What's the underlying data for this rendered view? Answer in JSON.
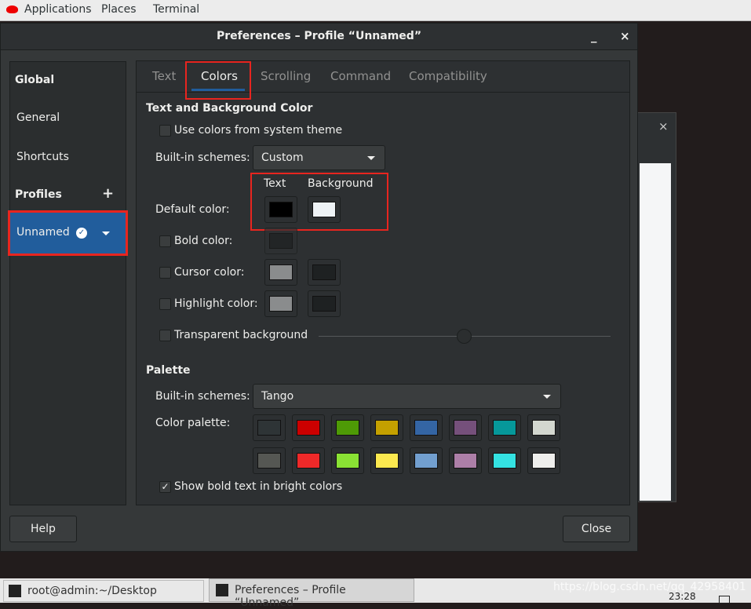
{
  "topbar": {
    "menus": [
      "Applications",
      "Places",
      "Terminal"
    ]
  },
  "dialog": {
    "title": "Preferences – Profile “Unnamed”",
    "close": "×"
  },
  "sidebar": {
    "global": "Global",
    "general": "General",
    "shortcuts": "Shortcuts",
    "profiles": "Profiles",
    "add": "+",
    "profile_name": "Unnamed"
  },
  "tabs": [
    "Text",
    "Colors",
    "Scrolling",
    "Command",
    "Compatibility"
  ],
  "text_bg": {
    "heading": "Text and Background Color",
    "use_system": "Use colors from system theme",
    "use_system_checked": false,
    "schemes_label": "Built-in schemes:",
    "scheme": "Custom",
    "col_text": "Text",
    "col_background": "Background",
    "default_label": "Default color:",
    "default_text": "#000000",
    "default_bg": "#eef2f5",
    "bold_label": "Bold color:",
    "bold_color": "#1e2122",
    "cursor_label": "Cursor color:",
    "cursor_fg": "#8a8c8d",
    "cursor_bg": "#1e2122",
    "highlight_label": "Highlight color:",
    "highlight_fg": "#8a8c8d",
    "highlight_bg": "#1e2122",
    "transparent_label": "Transparent background"
  },
  "palette": {
    "heading": "Palette",
    "schemes_label": "Built-in schemes:",
    "scheme": "Tango",
    "palette_label": "Color palette:",
    "colors": [
      "#2e3436",
      "#cc0000",
      "#4e9a06",
      "#c4a000",
      "#3465a4",
      "#75507b",
      "#06989a",
      "#d3d7cf",
      "#555753",
      "#ef2929",
      "#8ae234",
      "#fce94f",
      "#729fcf",
      "#ad7fa8",
      "#34e2e2",
      "#eeeeec"
    ],
    "bold_bright": "Show bold text in bright colors",
    "bold_bright_checked": true
  },
  "buttons": {
    "help": "Help",
    "close": "Close"
  },
  "taskbar": {
    "items": [
      "root@admin:~/Desktop",
      "Preferences – Profile “Unnamed”"
    ],
    "clock": "23:28",
    "watermark": "https://blog.csdn.net/qq_42958401"
  },
  "bgwindow": {
    "close": "×"
  }
}
